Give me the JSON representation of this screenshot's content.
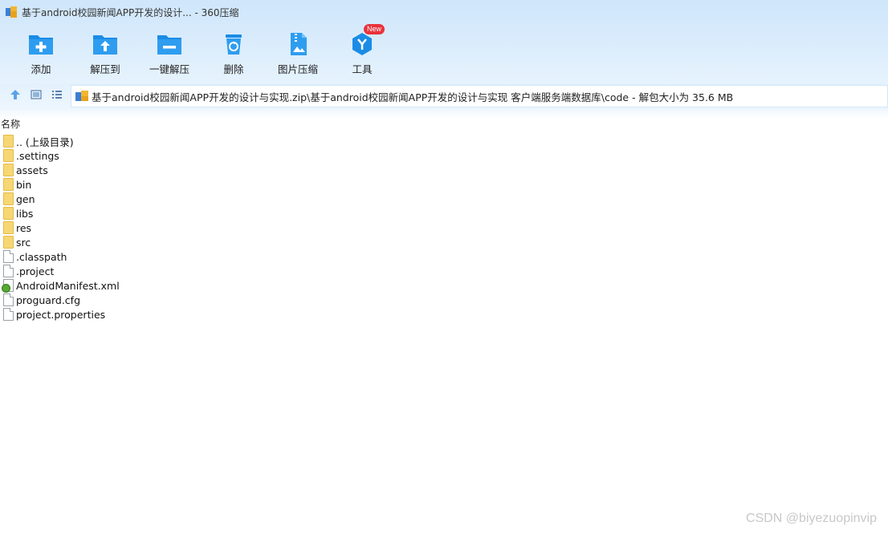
{
  "window": {
    "title": "基于android校园新闻APP开发的设计... - 360压缩"
  },
  "toolbar": {
    "items": [
      {
        "label": "添加",
        "icon": "add-icon"
      },
      {
        "label": "解压到",
        "icon": "extract-to-icon"
      },
      {
        "label": "一键解压",
        "icon": "one-click-extract-icon"
      },
      {
        "label": "删除",
        "icon": "delete-icon"
      },
      {
        "label": "图片压缩",
        "icon": "image-compress-icon"
      },
      {
        "label": "工具",
        "icon": "tools-icon",
        "badge": "New"
      }
    ]
  },
  "address": {
    "path": "基于android校园新闻APP开发的设计与实现.zip\\基于android校园新闻APP开发的设计与实现 客户端服务端数据库\\code - 解包大小为 35.6 MB"
  },
  "list": {
    "header": "名称",
    "items": [
      {
        "name": ".. (上级目录)",
        "type": "folder"
      },
      {
        "name": ".settings",
        "type": "folder"
      },
      {
        "name": "assets",
        "type": "folder"
      },
      {
        "name": "bin",
        "type": "folder"
      },
      {
        "name": "gen",
        "type": "folder"
      },
      {
        "name": "libs",
        "type": "folder"
      },
      {
        "name": "res",
        "type": "folder"
      },
      {
        "name": "src",
        "type": "folder"
      },
      {
        "name": ".classpath",
        "type": "file"
      },
      {
        "name": ".project",
        "type": "file"
      },
      {
        "name": "AndroidManifest.xml",
        "type": "xml"
      },
      {
        "name": "proguard.cfg",
        "type": "file"
      },
      {
        "name": "project.properties",
        "type": "file"
      }
    ]
  },
  "watermark": "CSDN @biyezuopinvip",
  "colors": {
    "accent": "#1a8ce6",
    "badge": "#e8323a",
    "folder": "#f7d774"
  }
}
